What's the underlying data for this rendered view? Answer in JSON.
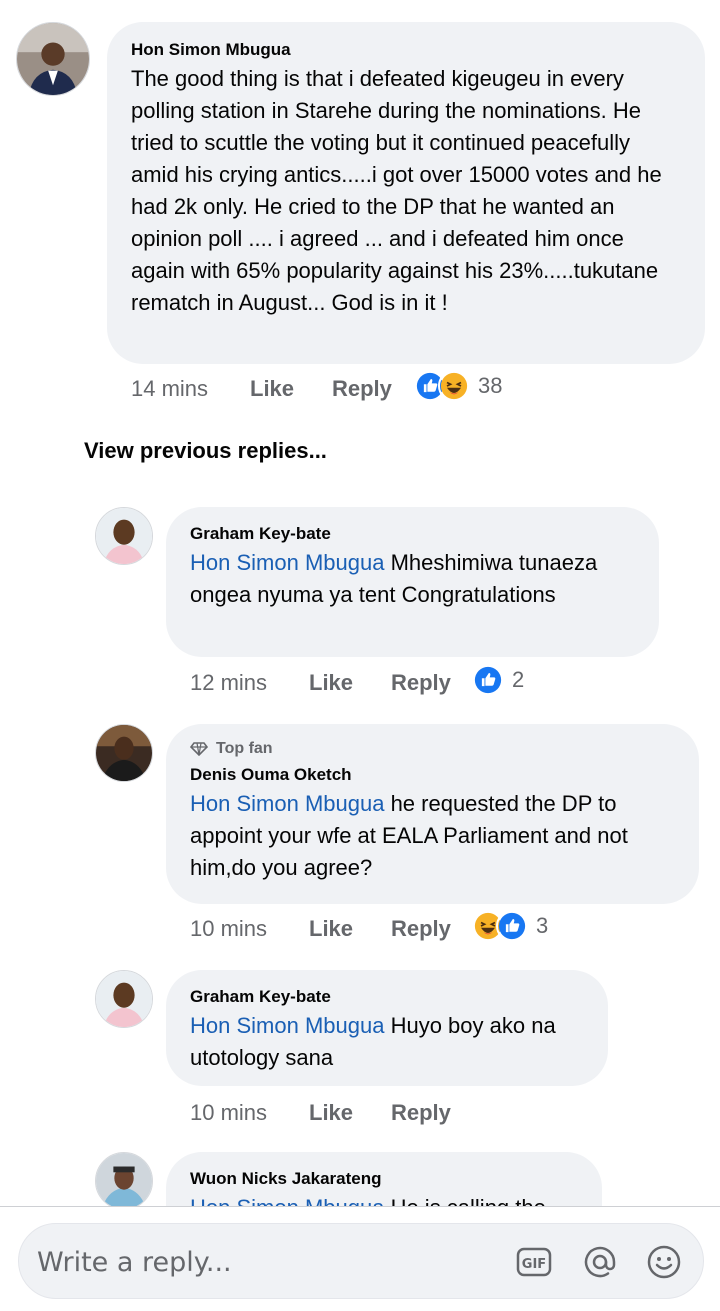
{
  "comments": [
    {
      "name": "Hon Simon Mbugua",
      "body": "The good thing is that i defeated kigeugeu in every polling station in Starehe during  the nominations. He tried to scuttle the voting but it continued peacefully amid his crying antics.....i got over 15000 votes and he had 2k only.  He cried  to the DP that he wanted an opinion poll .... i agreed ... and i defeated him once again  with 65% popularity against his 23%.....tukutane rematch in August... God is in it  !",
      "time": "14 mins",
      "like": "Like",
      "reply": "Reply",
      "reaction_count": "38"
    }
  ],
  "view_previous": "View previous replies...",
  "replies": [
    {
      "name": "Graham Key-bate",
      "mention": "Hon Simon Mbugua",
      "body": " Mheshimiwa tunaeza ongea nyuma ya tent Congratulations",
      "time": "12 mins",
      "like": "Like",
      "reply": "Reply",
      "reaction_count": "2"
    },
    {
      "badge": "Top fan",
      "name": "Denis Ouma Oketch",
      "mention": "Hon Simon Mbugua",
      "body": " he requested  the DP to appoint  your wfe at EALA Parliament and not him,do you agree?",
      "time": "10 mins",
      "like": "Like",
      "reply": "Reply",
      "reaction_count": "3"
    },
    {
      "name": "Graham Key-bate",
      "mention": "Hon Simon Mbugua",
      "body": " Huyo boy ako na utotology sana",
      "time": "10 mins",
      "like": "Like",
      "reply": "Reply"
    },
    {
      "name": "Wuon Nicks Jakarateng",
      "mention": "Hon Simon Mbugua",
      "body": " He is calling the"
    }
  ],
  "composer": {
    "placeholder": "Write a reply...",
    "icons": [
      "gif-icon",
      "at-mention-icon",
      "emoji-icon"
    ]
  },
  "colors": {
    "bubble": "#f0f2f5",
    "mention": "#1a5fb4",
    "like_blue": "#1877f2",
    "haha_yellow": "#f7b125",
    "meta_gray": "#65676b"
  }
}
